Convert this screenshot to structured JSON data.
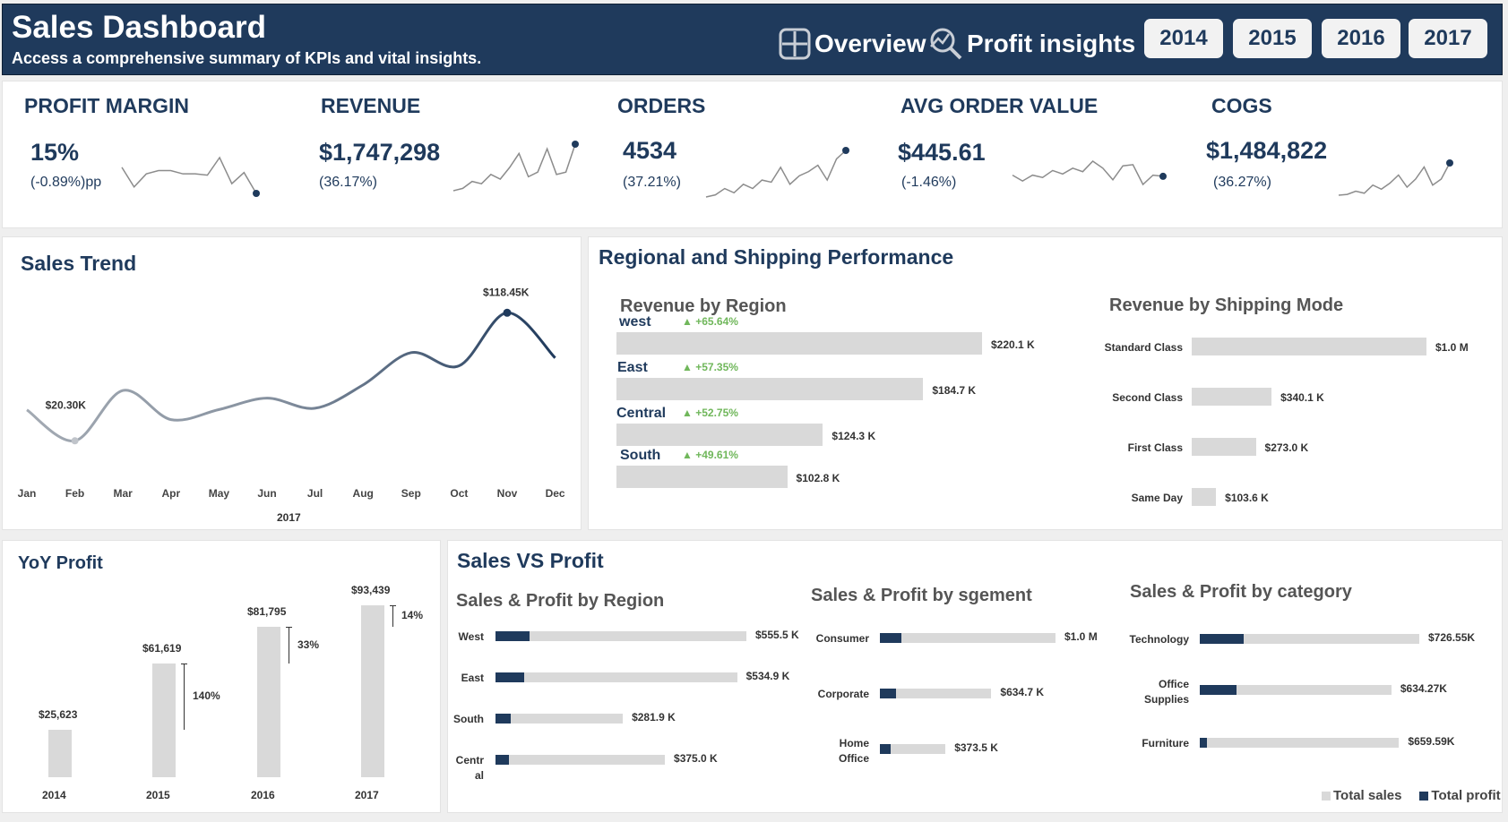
{
  "header": {
    "title": "Sales Dashboard",
    "subtitle": "Access a comprehensive summary of KPIs and vital insights.",
    "nav": [
      {
        "label": "Overview",
        "icon": "grid-icon"
      },
      {
        "label": "Profit insights",
        "icon": "analytics-search-icon"
      }
    ],
    "years": [
      "2014",
      "2015",
      "2016",
      "2017"
    ]
  },
  "kpis": [
    {
      "title": "PROFIT MARGIN",
      "value": "15%",
      "delta": "(-0.89%)pp",
      "spark": [
        6,
        3,
        5,
        5.5,
        5.5,
        5,
        5,
        4.8,
        7.5,
        3.5,
        5.2,
        2
      ]
    },
    {
      "title": "REVENUE",
      "value": "$1,747,298",
      "delta": "(36.17%)",
      "spark": [
        1,
        1.5,
        3,
        2.5,
        4.5,
        3.5,
        6,
        9,
        4,
        5,
        10,
        4.5,
        5,
        11
      ]
    },
    {
      "title": "ORDERS",
      "value": "4534",
      "delta": "(37.21%)",
      "spark": [
        1,
        1.5,
        3,
        2,
        4,
        3,
        5,
        4.5,
        8,
        4,
        6,
        7,
        8.5,
        5,
        10,
        12
      ]
    },
    {
      "title": "AVG ORDER VALUE",
      "value": "$445.61",
      "delta": "(-1.46%)",
      "spark": [
        5,
        4.5,
        5,
        4.8,
        5.4,
        5.1,
        5.6,
        5.3,
        6.2,
        5.6,
        4.6,
        5.8,
        5.9,
        4.2,
        5,
        4.9
      ]
    },
    {
      "title": "COGS",
      "value": "$1,484,822",
      "delta": "(36.27%)",
      "spark": [
        1,
        1.2,
        2,
        1.5,
        3.5,
        2.5,
        4,
        6,
        3,
        5,
        8,
        3.5,
        5,
        9
      ]
    }
  ],
  "sales_trend": {
    "title": "Sales Trend",
    "year_label": "2017",
    "min_label": "$20.30K",
    "max_label": "$118.45K"
  },
  "regional": {
    "title": "Regional and Shipping Performance",
    "by_region_title": "Revenue by Region",
    "by_shipping_title": "Revenue by Shipping Mode"
  },
  "yoy": {
    "title": "YoY Profit"
  },
  "sales_vs_profit": {
    "title": "Sales VS Profit",
    "by_region_title": "Sales & Profit by Region",
    "by_segment_title": "Sales & Profit by sgement",
    "by_category_title": "Sales & Profit by category",
    "legend": [
      "Total sales",
      "Total profit"
    ]
  },
  "colors": {
    "navy": "#1f3a5c",
    "gray": "#d9d9d9",
    "green": "#70b75b"
  },
  "chart_data": [
    {
      "type": "line",
      "title": "Sales Trend",
      "xlabel": "2017",
      "categories": [
        "Jan",
        "Feb",
        "Mar",
        "Apr",
        "May",
        "Jun",
        "Jul",
        "Aug",
        "Sep",
        "Oct",
        "Nov",
        "Dec"
      ],
      "values": [
        43.97,
        20.3,
        58.87,
        36.55,
        44.26,
        52.98,
        45.26,
        63.12,
        87.87,
        77.78,
        118.45,
        83.83
      ]
    },
    {
      "type": "bar",
      "title": "Revenue by Region",
      "categories": [
        "west",
        "East",
        "Central",
        "South"
      ],
      "values": [
        220.1,
        184.7,
        124.3,
        102.8
      ],
      "labels": [
        "$220.1 K",
        "$184.7 K",
        "$124.3 K",
        "$102.8 K"
      ],
      "growth": [
        "+65.64%",
        "+57.35%",
        "+52.75%",
        "+49.61%"
      ]
    },
    {
      "type": "bar",
      "title": "Revenue by Shipping Mode",
      "categories": [
        "Standard Class",
        "Second Class",
        "First Class",
        "Same Day"
      ],
      "values": [
        1000,
        340.1,
        273.0,
        103.6
      ],
      "labels": [
        "$1.0 M",
        "$340.1 K",
        "$273.0 K",
        "$103.6 K"
      ]
    },
    {
      "type": "bar",
      "title": "YoY Profit",
      "categories": [
        "2014",
        "2015",
        "2016",
        "2017"
      ],
      "values": [
        25623,
        61619,
        81795,
        93439
      ],
      "labels": [
        "$25,623",
        "$61,619",
        "$81,795",
        "$93,439"
      ],
      "growth": [
        "",
        "140%",
        "33%",
        "14%"
      ]
    },
    {
      "type": "bar",
      "title": "Sales & Profit by Region",
      "categories": [
        "West",
        "East",
        "South",
        "Centr al"
      ],
      "series": [
        {
          "name": "Total sales",
          "values": [
            555.5,
            534.9,
            281.9,
            375.0
          ]
        },
        {
          "name": "Total profit",
          "values": [
            74.6,
            62.9,
            34.7,
            29.3
          ]
        }
      ],
      "labels": [
        "$555.5 K",
        "$534.9 K",
        "$281.9 K",
        "$375.0 K"
      ]
    },
    {
      "type": "bar",
      "title": "Sales & Profit by sgement",
      "categories": [
        "Consumer",
        "Corporate",
        "Home Office"
      ],
      "series": [
        {
          "name": "Total sales",
          "values": [
            1000,
            634.7,
            373.5
          ]
        },
        {
          "name": "Total profit",
          "values": [
            120,
            92,
            60
          ]
        }
      ],
      "labels": [
        "$1.0 M",
        "$634.7 K",
        "$373.5 K"
      ]
    },
    {
      "type": "bar",
      "title": "Sales & Profit by category",
      "categories": [
        "Technology",
        "Office Supplies",
        "Furniture"
      ],
      "series": [
        {
          "name": "Total sales",
          "values": [
            726.55,
            634.27,
            659.59
          ]
        },
        {
          "name": "Total profit",
          "values": [
            145,
            122,
            18
          ]
        }
      ],
      "labels": [
        "$726.55K",
        "$634.27K",
        "$659.59K"
      ]
    }
  ]
}
